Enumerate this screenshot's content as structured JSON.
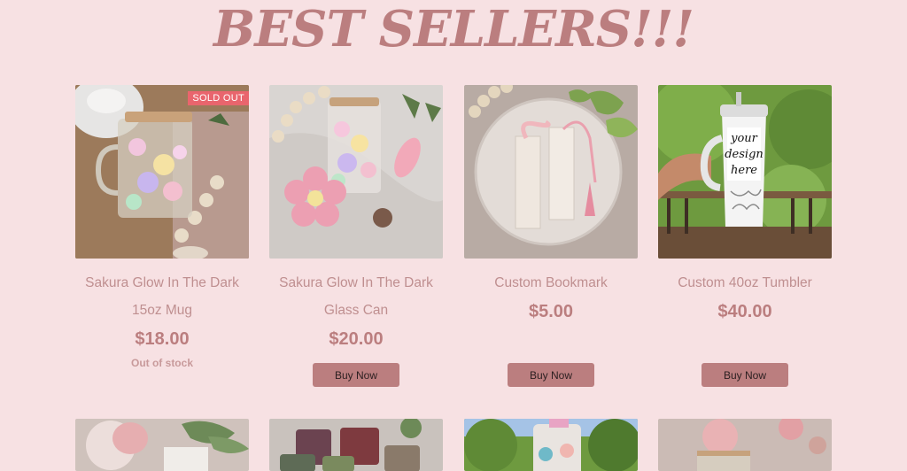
{
  "section": {
    "title": "BEST SELLERS!!!"
  },
  "products": [
    {
      "name_line1": "Sakura Glow In The Dark",
      "name_line2": "15oz Mug",
      "price": "$18.00",
      "badge": "SOLD OUT",
      "stock_status": "Out of stock"
    },
    {
      "name_line1": "Sakura Glow In The Dark",
      "name_line2": "Glass Can",
      "price": "$20.00",
      "button": "Buy Now"
    },
    {
      "name_line1": "Custom Bookmark",
      "price": "$5.00",
      "button": "Buy Now"
    },
    {
      "name_line1": "Custom 40oz Tumbler",
      "price": "$40.00",
      "button": "Buy Now",
      "image_text": [
        "your",
        "design",
        "here"
      ]
    }
  ],
  "colors": {
    "background": "#f7e1e3",
    "accent": "#bb7e7f",
    "sold_out_badge": "#e9656d"
  }
}
